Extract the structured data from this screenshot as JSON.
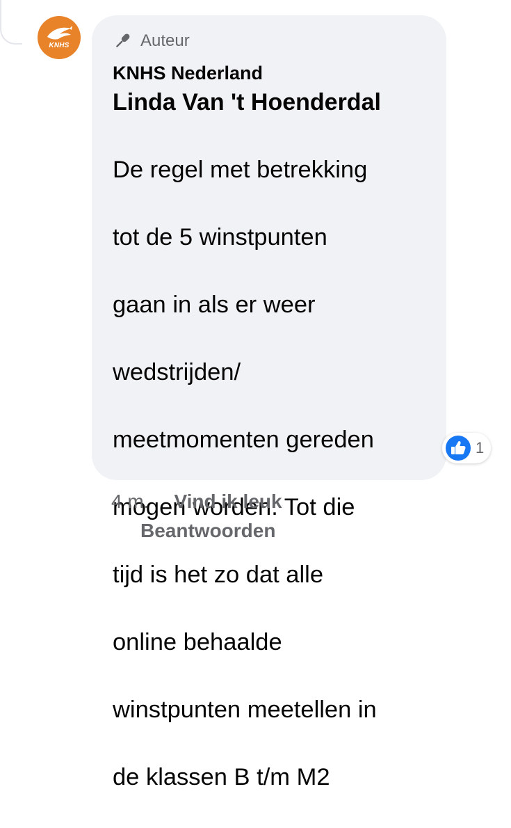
{
  "avatar": {
    "brand_text": "KNHS",
    "bg_color": "#e8832a"
  },
  "comment": {
    "badge": {
      "icon": "microphone-icon",
      "label": "Auteur"
    },
    "page_name": "KNHS Nederland",
    "mention": "Linda Van 't Hoenderdal",
    "lines": [
      "De regel met betrekking",
      "tot de 5 winstpunten",
      "gaan in als er weer",
      "wedstrijden/",
      "meetmomenten gereden",
      "mogen worden. Tot die",
      "tijd is het zo dat alle",
      "online behaalde",
      "winstpunten meetellen in",
      "de klassen B t/m M2"
    ],
    "bubble_color": "#f0f2f5"
  },
  "reaction": {
    "icon": "thumbs-up-icon",
    "count": "1",
    "color": "#1877f2"
  },
  "actions": {
    "timestamp": "4 m.",
    "like_label": "Vind ik leuk",
    "reply_label": "Beantwoorden"
  }
}
